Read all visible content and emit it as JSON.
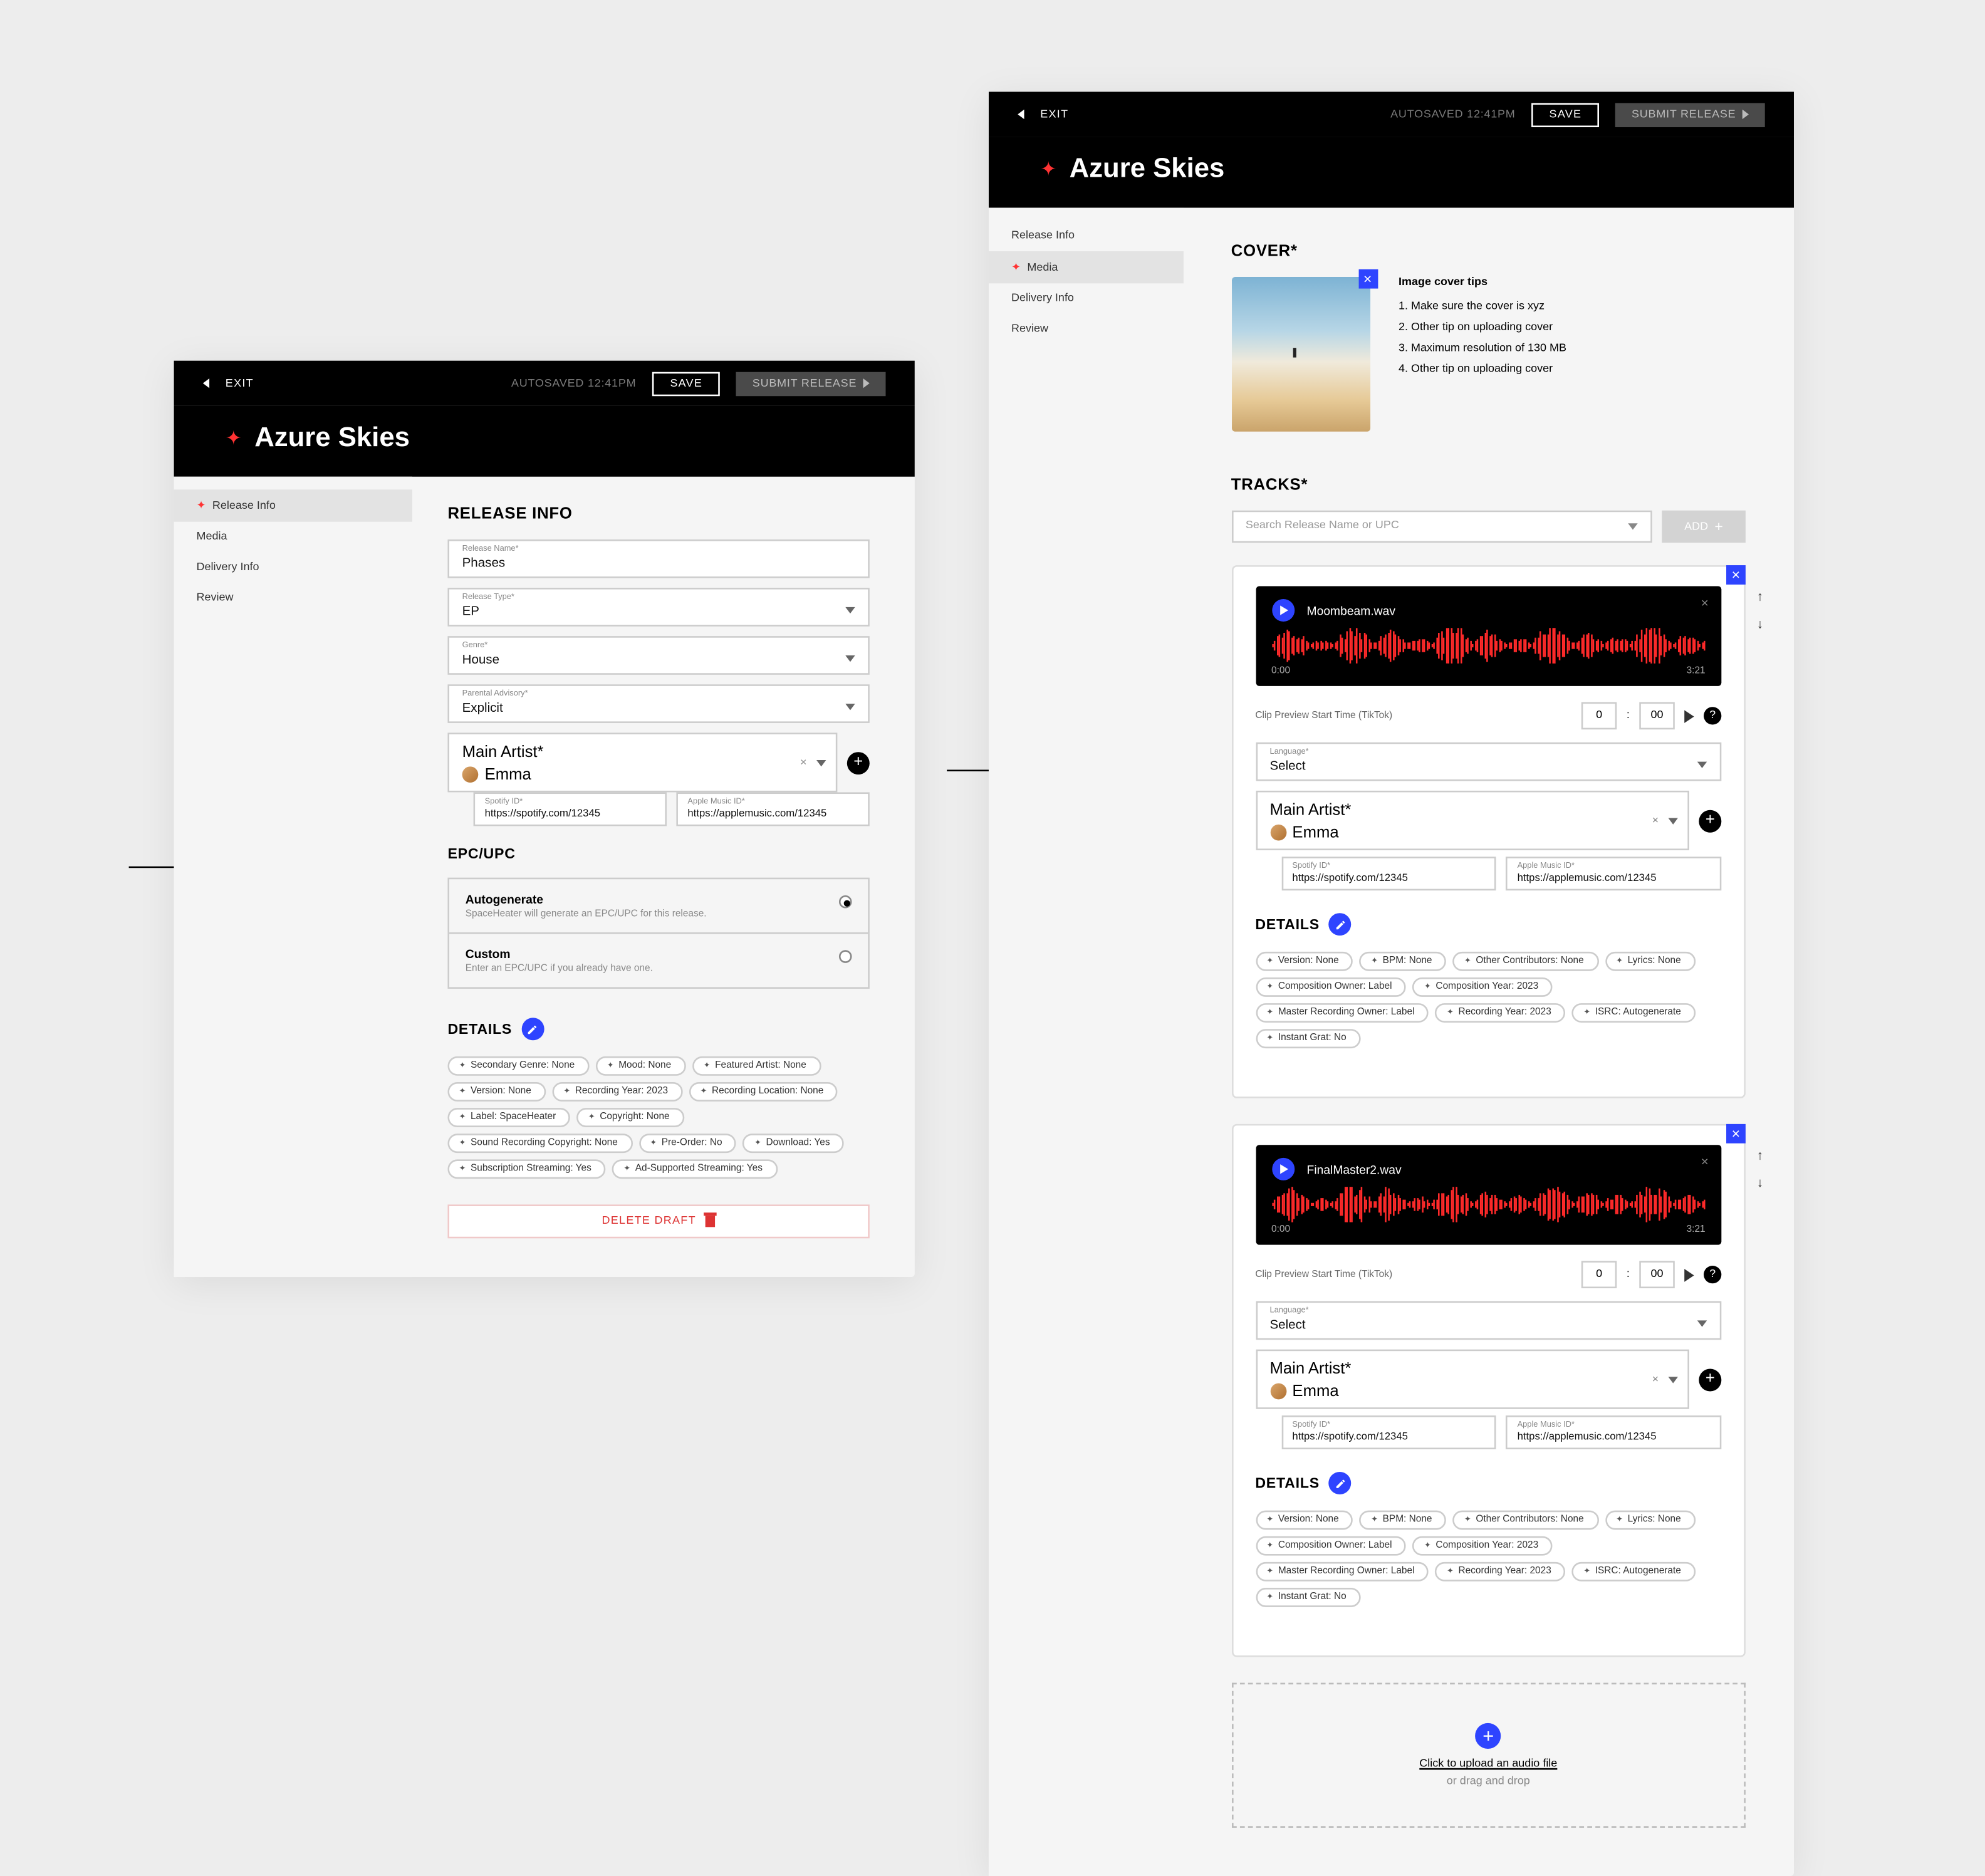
{
  "topbar": {
    "exit": "EXIT",
    "autosaved": "AUTOSAVED 12:41PM",
    "save": "SAVE",
    "submit": "SUBMIT RELEASE"
  },
  "release_title": "Azure Skies",
  "sidebar": {
    "release_info": "Release Info",
    "media": "Media",
    "delivery_info": "Delivery Info",
    "review": "Review"
  },
  "left": {
    "heading": "RELEASE INFO",
    "fields": {
      "release_name_label": "Release Name*",
      "release_name_value": "Phases",
      "release_type_label": "Release Type*",
      "release_type_value": "EP",
      "genre_label": "Genre*",
      "genre_value": "House",
      "parental_label": "Parental Advisory*",
      "parental_value": "Explicit",
      "main_artist_label": "Main Artist*",
      "main_artist_value": "Emma",
      "spotify_label": "Spotify ID*",
      "spotify_value": "https://spotify.com/12345",
      "apple_label": "Apple Music ID*",
      "apple_value": "https://applemusic.com/12345"
    },
    "epc_heading": "EPC/UPC",
    "epc_opts": {
      "auto_title": "Autogenerate",
      "auto_desc": "SpaceHeater will generate an EPC/UPC for this release.",
      "custom_title": "Custom",
      "custom_desc": "Enter an EPC/UPC if you already have one."
    },
    "details_heading": "DETAILS",
    "chips": [
      "Secondary Genre: None",
      "Mood: None",
      "Featured Artist: None",
      "Version: None",
      "Recording Year: 2023",
      "Recording Location: None",
      "Label: SpaceHeater",
      "Copyright: None",
      "Sound Recording Copyright: None",
      "Pre-Order: No",
      "Download: Yes",
      "Subscription Streaming: Yes",
      "Ad-Supported Streaming: Yes"
    ],
    "delete": "DELETE DRAFT"
  },
  "right": {
    "cover_heading": "COVER*",
    "tips_heading": "Image cover tips",
    "tips": [
      "1. Make sure the cover is xyz",
      "2. Other tip on uploading cover",
      "3. Maximum resolution of 130 MB",
      "4. Other tip on uploading cover"
    ],
    "tracks_heading": "TRACKS*",
    "search_placeholder": "Search Release Name or UPC",
    "add_label": "ADD",
    "clip_label": "Clip Preview Start Time (TikTok)",
    "time_mm": "0",
    "time_ss": "00",
    "lang_label": "Language*",
    "lang_value": "Select",
    "artist_label": "Main Artist*",
    "artist_value": "Emma",
    "spotify_label": "Spotify ID*",
    "spotify_value": "https://spotify.com/12345",
    "apple_label": "Apple Music ID*",
    "apple_value": "https://applemusic.com/12345",
    "details_heading": "DETAILS",
    "track_chips": [
      "Version: None",
      "BPM: None",
      "Other Contributors: None",
      "Lyrics: None",
      "Composition Owner: Label",
      "Composition Year: 2023",
      "Master Recording Owner: Label",
      "Recording Year: 2023",
      "ISRC: Autogenerate",
      "Instant Grat: No"
    ],
    "tracks": [
      {
        "name": "Moombeam.wav",
        "start": "0:00",
        "end": "3:21"
      },
      {
        "name": "FinalMaster2.wav",
        "start": "0:00",
        "end": "3:21"
      }
    ],
    "upload_link": "Click to upload an audio file",
    "upload_sub": "or drag and drop"
  }
}
